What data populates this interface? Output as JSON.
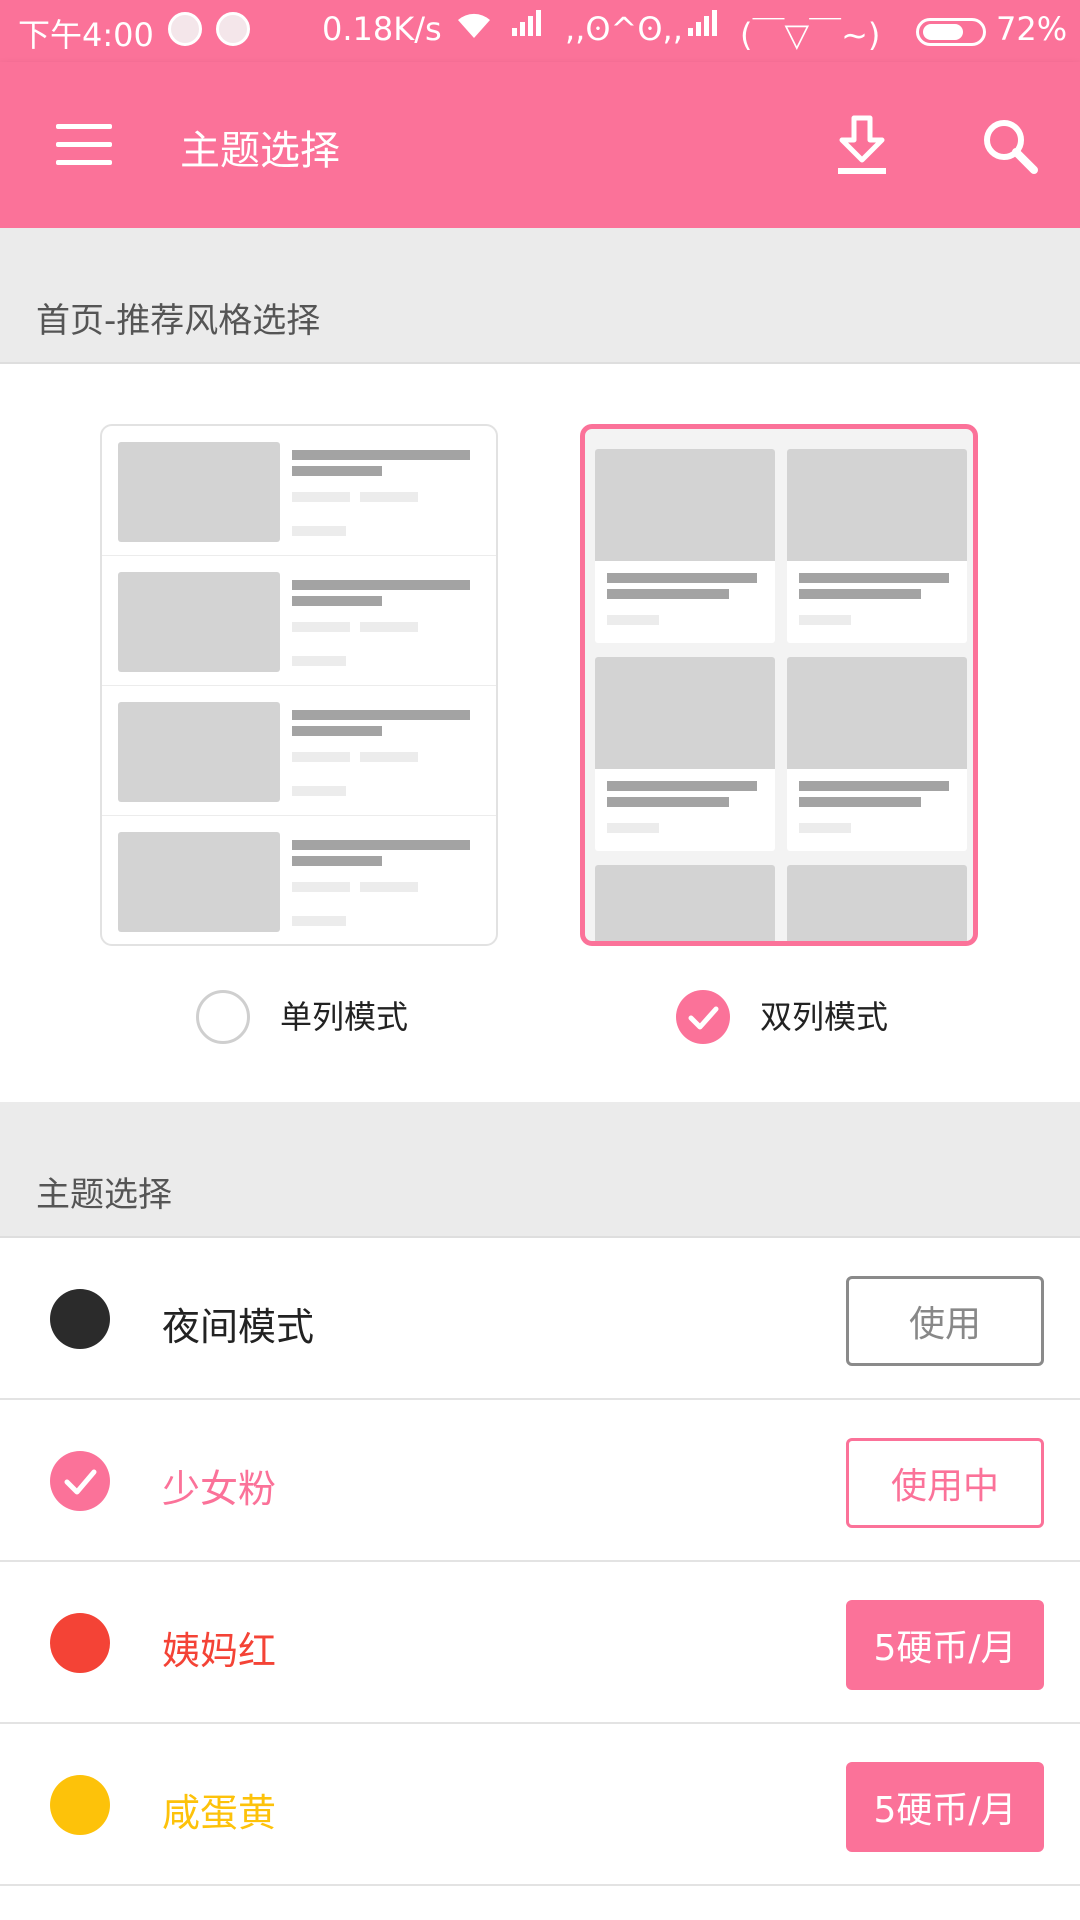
{
  "status_bar": {
    "time": "下午4:00",
    "net_speed": "0.18K/s",
    "kaomoji_1": ",,ʘ^ʘ,,",
    "kaomoji_2": "(￣▽￣~)",
    "battery": "72%",
    "battery_level": 0.72
  },
  "app_bar": {
    "title": "主题选择",
    "menu_icon": "hamburger-menu-icon",
    "download_icon": "download-icon",
    "search_icon": "search-icon"
  },
  "home_style": {
    "header": "首页-推荐风格选择",
    "options": [
      {
        "label": "单列模式",
        "selected": false
      },
      {
        "label": "双列模式",
        "selected": true
      }
    ]
  },
  "themes": {
    "header": "主题选择",
    "items": [
      {
        "name": "夜间模式",
        "color": "#2b2b2b",
        "button": "使用",
        "state": "use"
      },
      {
        "name": "少女粉",
        "color": "#fb7299",
        "button": "使用中",
        "state": "in-use"
      },
      {
        "name": "姨妈红",
        "color": "#f44336",
        "button": "5硬币/月",
        "state": "buy"
      },
      {
        "name": "咸蛋黄",
        "color": "#fdc20a",
        "button": "5硬币/月",
        "state": "buy"
      }
    ]
  },
  "colors": {
    "accent": "#fb7299",
    "section_bg": "#ebebeb"
  }
}
